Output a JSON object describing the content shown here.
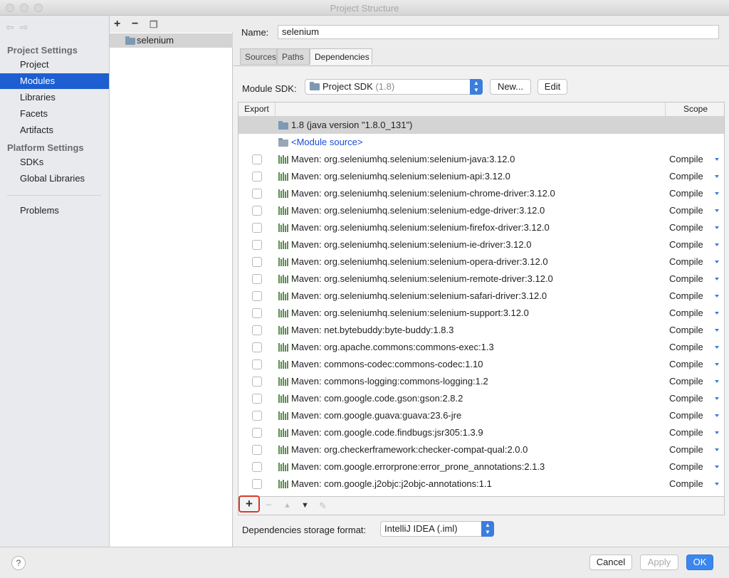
{
  "window": {
    "title": "Project Structure"
  },
  "sidebar": {
    "project_settings_label": "Project Settings",
    "project_items": [
      "Project",
      "Modules",
      "Libraries",
      "Facets",
      "Artifacts"
    ],
    "platform_settings_label": "Platform Settings",
    "platform_items": [
      "SDKs",
      "Global Libraries"
    ],
    "problems_label": "Problems",
    "selected": "Modules"
  },
  "module_tree": {
    "toolbar": {
      "add": "+",
      "remove": "−"
    },
    "modules": [
      "selenium"
    ]
  },
  "main": {
    "name_label": "Name:",
    "name_value": "selenium",
    "tabs": [
      "Sources",
      "Paths",
      "Dependencies"
    ],
    "active_tab": "Dependencies",
    "sdk_label": "Module SDK:",
    "sdk_value": "Project SDK",
    "sdk_version": "(1.8)",
    "new_button": "New...",
    "edit_button": "Edit",
    "table": {
      "headers": {
        "export": "Export",
        "scope": "Scope"
      },
      "sdk_row": "1.8 (java version \"1.8.0_131\")",
      "module_source_row": "<Module source>",
      "dependencies": [
        {
          "name": "Maven: org.seleniumhq.selenium:selenium-java:3.12.0",
          "scope": "Compile"
        },
        {
          "name": "Maven: org.seleniumhq.selenium:selenium-api:3.12.0",
          "scope": "Compile"
        },
        {
          "name": "Maven: org.seleniumhq.selenium:selenium-chrome-driver:3.12.0",
          "scope": "Compile"
        },
        {
          "name": "Maven: org.seleniumhq.selenium:selenium-edge-driver:3.12.0",
          "scope": "Compile"
        },
        {
          "name": "Maven: org.seleniumhq.selenium:selenium-firefox-driver:3.12.0",
          "scope": "Compile"
        },
        {
          "name": "Maven: org.seleniumhq.selenium:selenium-ie-driver:3.12.0",
          "scope": "Compile"
        },
        {
          "name": "Maven: org.seleniumhq.selenium:selenium-opera-driver:3.12.0",
          "scope": "Compile"
        },
        {
          "name": "Maven: org.seleniumhq.selenium:selenium-remote-driver:3.12.0",
          "scope": "Compile"
        },
        {
          "name": "Maven: org.seleniumhq.selenium:selenium-safari-driver:3.12.0",
          "scope": "Compile"
        },
        {
          "name": "Maven: org.seleniumhq.selenium:selenium-support:3.12.0",
          "scope": "Compile"
        },
        {
          "name": "Maven: net.bytebuddy:byte-buddy:1.8.3",
          "scope": "Compile"
        },
        {
          "name": "Maven: org.apache.commons:commons-exec:1.3",
          "scope": "Compile"
        },
        {
          "name": "Maven: commons-codec:commons-codec:1.10",
          "scope": "Compile"
        },
        {
          "name": "Maven: commons-logging:commons-logging:1.2",
          "scope": "Compile"
        },
        {
          "name": "Maven: com.google.code.gson:gson:2.8.2",
          "scope": "Compile"
        },
        {
          "name": "Maven: com.google.guava:guava:23.6-jre",
          "scope": "Compile"
        },
        {
          "name": "Maven: com.google.code.findbugs:jsr305:1.3.9",
          "scope": "Compile"
        },
        {
          "name": "Maven: org.checkerframework:checker-compat-qual:2.0.0",
          "scope": "Compile"
        },
        {
          "name": "Maven: com.google.errorprone:error_prone_annotations:2.1.3",
          "scope": "Compile"
        },
        {
          "name": "Maven: com.google.j2objc:j2objc-annotations:1.1",
          "scope": "Compile"
        }
      ]
    },
    "table_toolbar": {
      "add": "+",
      "remove": "−",
      "up": "▲",
      "down": "▼",
      "edit": "✎"
    },
    "storage_format_label": "Dependencies storage format:",
    "storage_format_value": "IntelliJ IDEA (.iml)"
  },
  "footer": {
    "help": "?",
    "cancel": "Cancel",
    "apply": "Apply",
    "ok": "OK"
  },
  "colors": {
    "selection": "#1d5ed1",
    "accent": "#3b7ddd",
    "highlight_border": "#d63b2f",
    "library_icon": "#5a8e4d"
  }
}
